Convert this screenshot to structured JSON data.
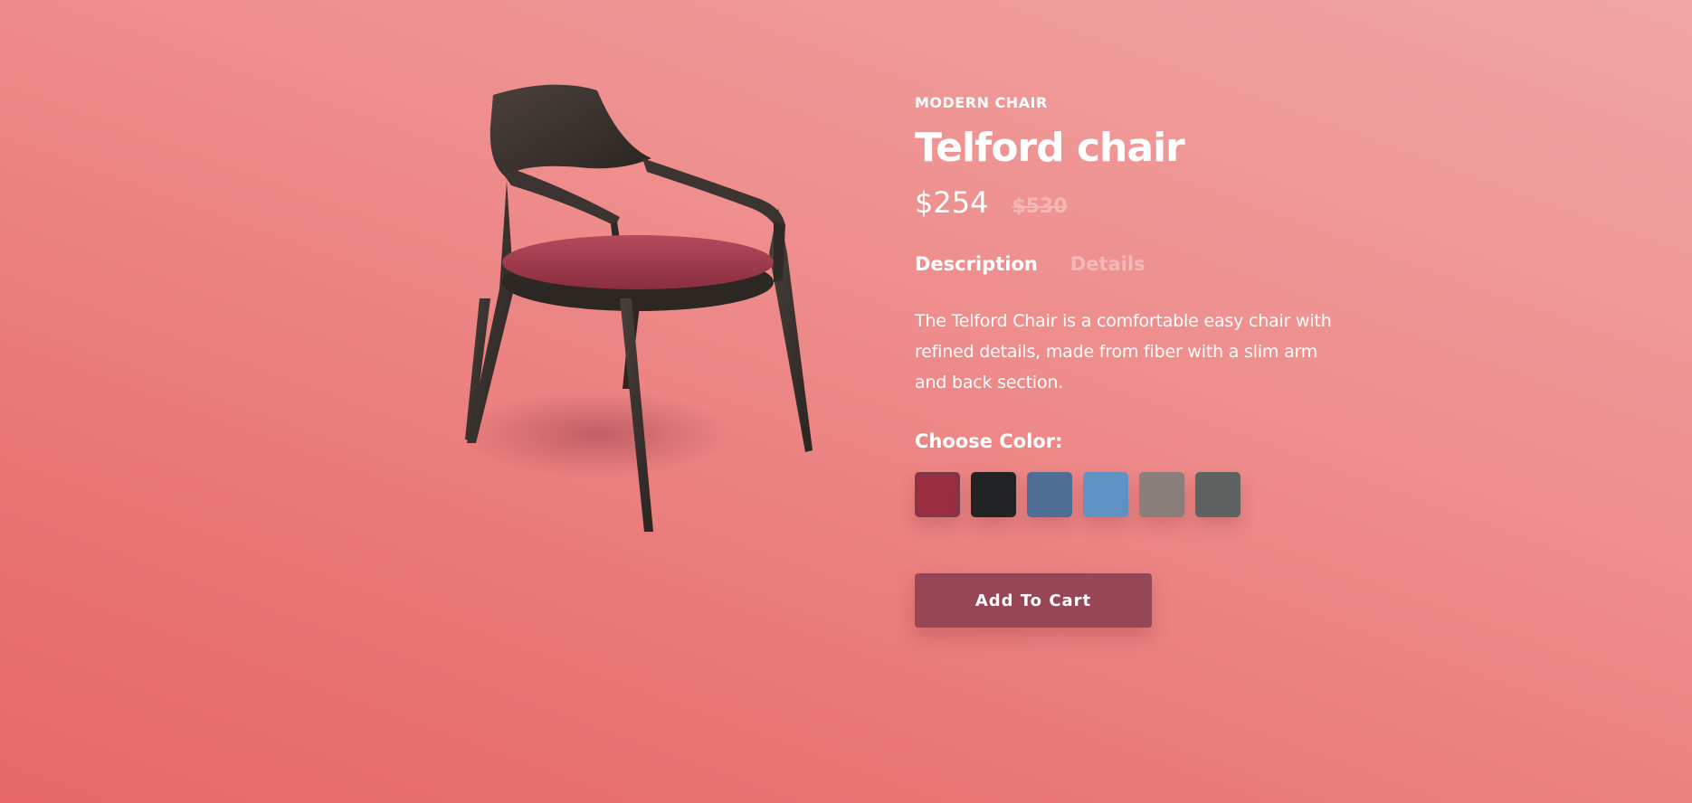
{
  "product": {
    "category": "MODERN CHAIR",
    "name": "Telford chair",
    "price": "$254",
    "old_price": "$530",
    "image_icon": "chair-image"
  },
  "tabs": [
    {
      "label": "Description",
      "active": true
    },
    {
      "label": "Details",
      "active": false
    }
  ],
  "description": "The Telford Chair is a comfortable easy chair with refined details, made from fiber with a slim arm and back section.",
  "colors": {
    "label": "Choose Color:",
    "swatches": [
      {
        "name": "red",
        "hex": "#9a2e40",
        "selected": true
      },
      {
        "name": "black",
        "hex": "#222325",
        "selected": false
      },
      {
        "name": "denim-blue",
        "hex": "#4f6e95",
        "selected": false
      },
      {
        "name": "light-blue",
        "hex": "#5e93c4",
        "selected": false
      },
      {
        "name": "taupe",
        "hex": "#8a7e7a",
        "selected": false
      },
      {
        "name": "grey",
        "hex": "#5e6261",
        "selected": false
      }
    ]
  },
  "cart": {
    "label": "Add To Cart"
  },
  "theme": {
    "accent": "#964654",
    "background_top": "#f0a5a4",
    "background_bottom": "#e66869"
  }
}
